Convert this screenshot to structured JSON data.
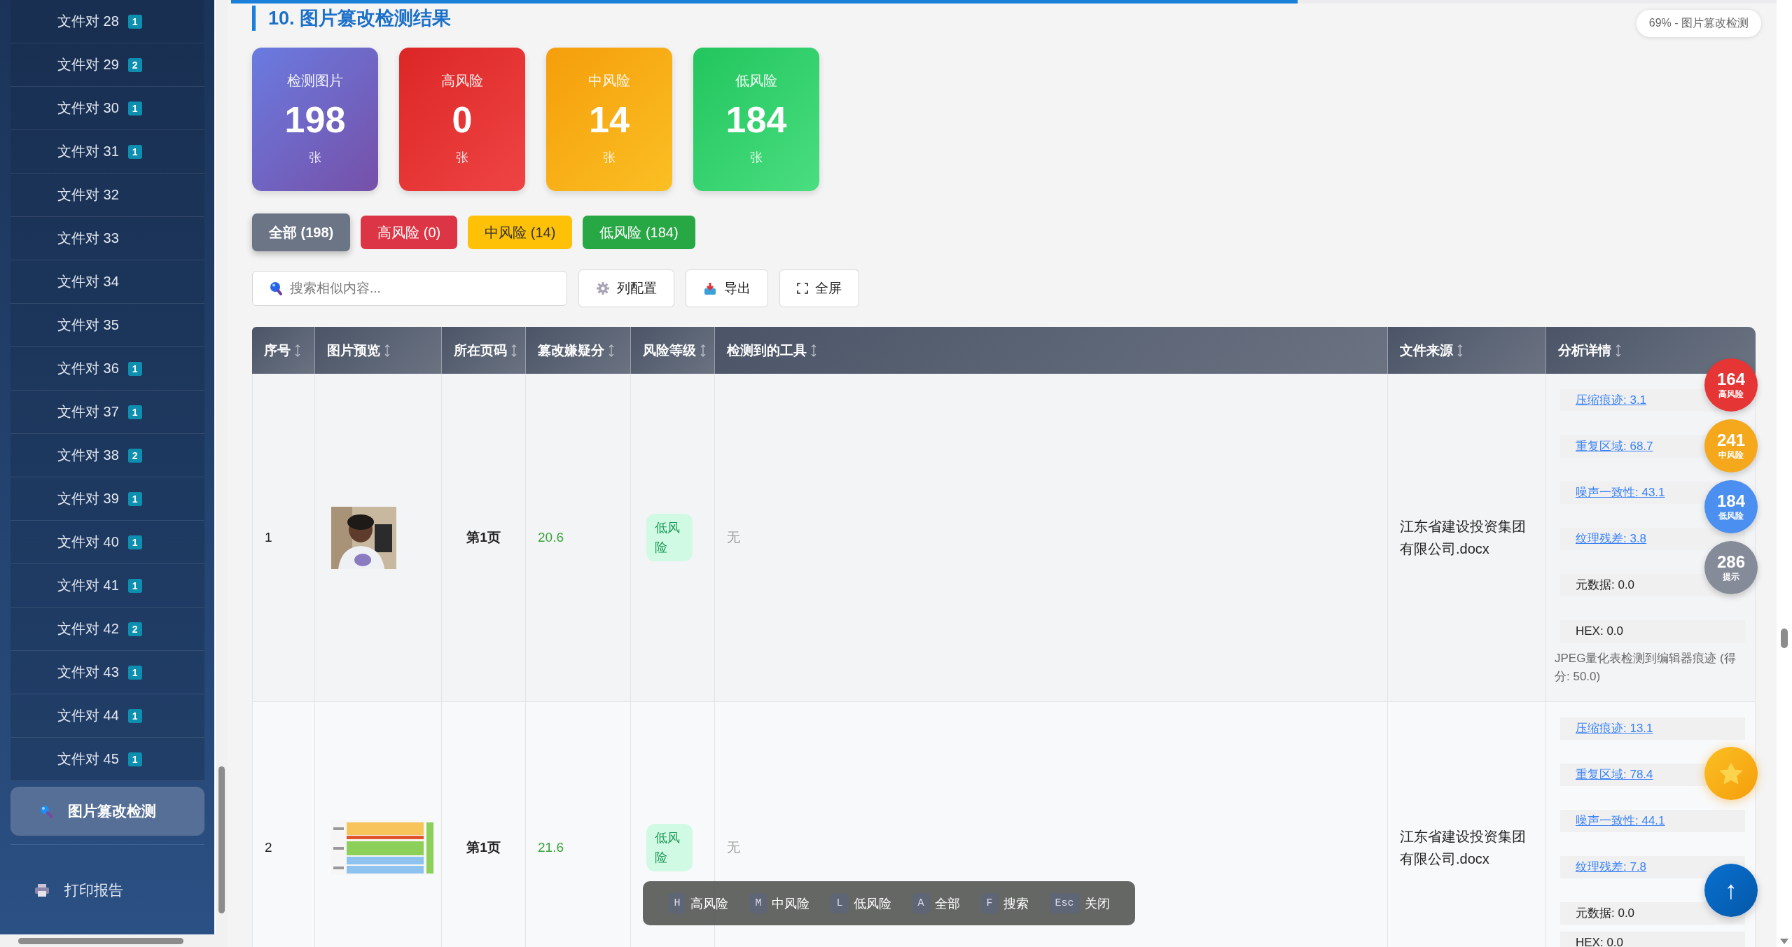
{
  "sidebar": {
    "items": [
      {
        "label": "文件对 28",
        "badge": "1",
        "selected": false
      },
      {
        "label": "文件对 29",
        "badge": "2",
        "selected": false
      },
      {
        "label": "文件对 30",
        "badge": "1",
        "selected": false
      },
      {
        "label": "文件对 31",
        "badge": "1",
        "selected": false
      },
      {
        "label": "文件对 32",
        "selected": false
      },
      {
        "label": "文件对 33",
        "selected": false
      },
      {
        "label": "文件对 34",
        "selected": false
      },
      {
        "label": "文件对 35",
        "selected": false
      },
      {
        "label": "文件对 36",
        "badge": "1",
        "selected": false
      },
      {
        "label": "文件对 37",
        "badge": "1",
        "selected": false
      },
      {
        "label": "文件对 38",
        "badge": "2",
        "selected": false
      },
      {
        "label": "文件对 39",
        "badge": "1",
        "selected": false
      },
      {
        "label": "文件对 40",
        "badge": "1",
        "selected": false
      },
      {
        "label": "文件对 41",
        "badge": "1",
        "selected": false
      },
      {
        "label": "文件对 42",
        "badge": "2",
        "selected": false
      },
      {
        "label": "文件对 43",
        "badge": "1",
        "selected": false
      },
      {
        "label": "文件对 44",
        "badge": "1",
        "selected": false
      },
      {
        "label": "文件对 45",
        "badge": "1",
        "selected": false
      }
    ],
    "nav": [
      {
        "label": "图片篡改检测",
        "kind": "detect",
        "selected": true
      },
      {
        "label": "打印报告",
        "kind": "print",
        "selected": false
      }
    ]
  },
  "progress": {
    "level": 0.69,
    "label": "69% - 图片篡改检测"
  },
  "section_title": "10. 图片篡改检测结果",
  "stats": [
    {
      "label": "检测图片",
      "value": "198",
      "unit": "张",
      "kind": "total"
    },
    {
      "label": "高风险",
      "value": "0",
      "unit": "张",
      "kind": "high"
    },
    {
      "label": "中风险",
      "value": "14",
      "unit": "张",
      "kind": "medium"
    },
    {
      "label": "低风险",
      "value": "184",
      "unit": "张",
      "kind": "low"
    }
  ],
  "filters": [
    {
      "label": "全部 (198)",
      "kind": "all",
      "selected": true
    },
    {
      "label": "高风险 (0)",
      "kind": "high",
      "selected": false
    },
    {
      "label": "中风险 (14)",
      "kind": "medium",
      "selected": false
    },
    {
      "label": "低风险 (184)",
      "kind": "low",
      "selected": false
    }
  ],
  "search": {
    "placeholder": "搜索相似内容..."
  },
  "toolbar": [
    {
      "label": "列配置",
      "kind": "columns"
    },
    {
      "label": "导出",
      "kind": "export"
    },
    {
      "label": "全屏",
      "kind": "fullscreen"
    }
  ],
  "table": {
    "columns": [
      "序号",
      "图片预览",
      "所在页码",
      "篡改嫌疑分",
      "风险等级",
      "检测到的工具",
      "文件来源",
      "分析详情"
    ],
    "rows": [
      {
        "index": "1",
        "page": "第1页",
        "score": "20.6",
        "risk": "低风险",
        "tools": "无",
        "source": "江东省建设投资集团有限公司.docx",
        "details": [
          {
            "text": "压缩痕迹: 3.1",
            "kind": "link"
          },
          {
            "text": "重复区域: 68.7",
            "kind": "link"
          },
          {
            "text": "噪声一致性: 43.1",
            "kind": "link"
          },
          {
            "text": "纹理残差: 3.8",
            "kind": "link"
          },
          {
            "text": "元数据: 0.0",
            "kind": "plain"
          },
          {
            "text": "HEX: 0.0",
            "kind": "plain"
          }
        ],
        "note": "JPEG量化表检测到编辑器痕迹 (得分: 50.0)"
      },
      {
        "index": "2",
        "page": "第1页",
        "score": "21.6",
        "risk": "低风险",
        "tools": "无",
        "source": "江东省建设投资集团有限公司.docx",
        "details": [
          {
            "text": "压缩痕迹: 13.1",
            "kind": "link"
          },
          {
            "text": "重复区域: 78.4",
            "kind": "link"
          },
          {
            "text": "噪声一致性: 44.1",
            "kind": "link"
          },
          {
            "text": "纹理残差: 7.8",
            "kind": "link"
          },
          {
            "text": "元数据: 0.0",
            "kind": "plain"
          },
          {
            "text": "HEX: 0.0",
            "kind": "plain"
          }
        ]
      }
    ]
  },
  "float_counts": [
    {
      "value": "164",
      "label": "高风险",
      "color": "#e53535"
    },
    {
      "value": "241",
      "label": "中风险",
      "color": "#f5a81c"
    },
    {
      "value": "184",
      "label": "低风险",
      "color": "#4b8ff0"
    },
    {
      "value": "286",
      "label": "提示",
      "color": "#868b99"
    }
  ],
  "float_buttons": [
    {
      "kind": "star"
    },
    {
      "kind": "top",
      "label": "↑"
    }
  ],
  "shortcuts": [
    {
      "key": "H",
      "label": "高风险"
    },
    {
      "key": "M",
      "label": "中风险"
    },
    {
      "key": "L",
      "label": "低风险"
    },
    {
      "key": "A",
      "label": "全部"
    },
    {
      "key": "F",
      "label": "搜索"
    },
    {
      "key": "Esc",
      "label": "关闭"
    }
  ]
}
